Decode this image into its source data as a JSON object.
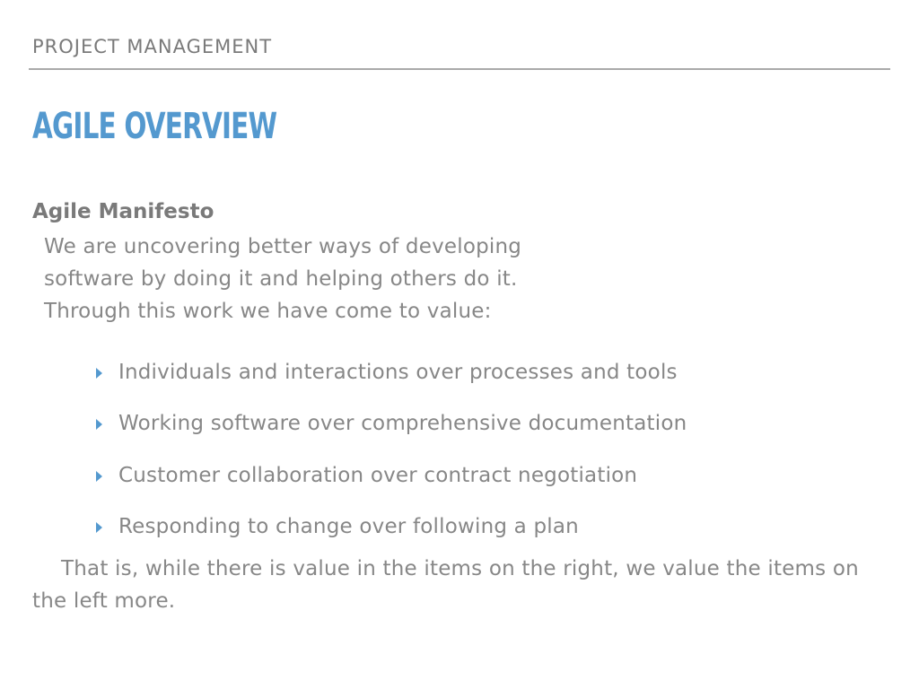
{
  "header": {
    "label": "PROJECT MANAGEMENT"
  },
  "title": "AGILE OVERVIEW",
  "section": {
    "heading": "Agile Manifesto",
    "intro_lines": [
      "We are uncovering better ways of developing",
      "software by doing it and helping others do it.",
      "Through this work we have come to value:"
    ]
  },
  "values": [
    "Individuals and interactions over processes and tools",
    "Working software over comprehensive documentation",
    "Customer collaboration over contract negotiation",
    "Responding to change over following a plan"
  ],
  "closing": "That is, while there is value in the items on the right, we value the items on the left more.",
  "colors": {
    "accent": "#5499cf",
    "text": "#878787",
    "rule": "#aaaaaa"
  },
  "icons": {
    "bullet": "triangle-right-icon"
  }
}
